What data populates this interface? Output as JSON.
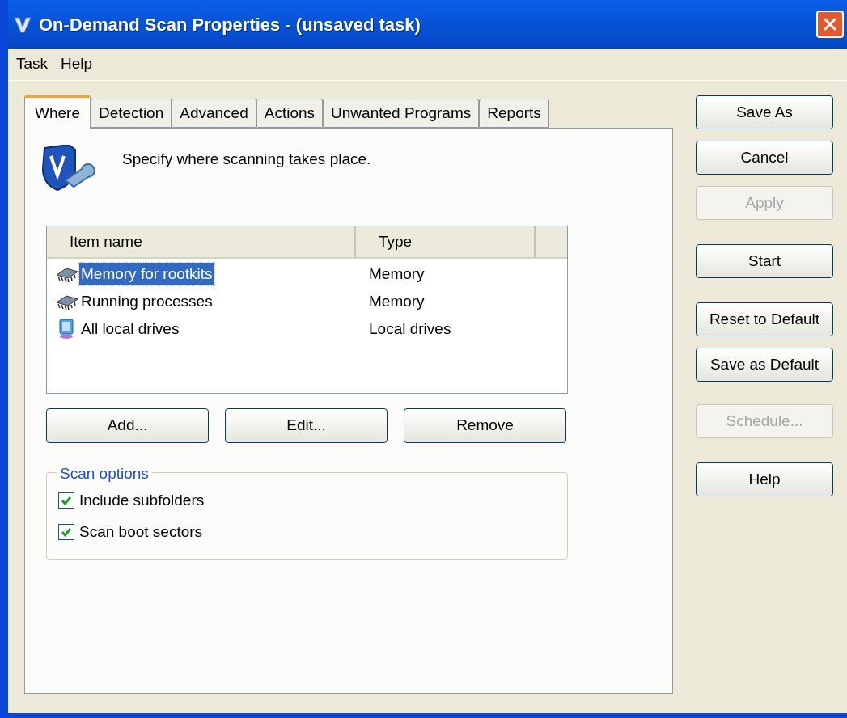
{
  "window": {
    "title": "On-Demand Scan Properties - (unsaved task)"
  },
  "menu": [
    "Task",
    "Help"
  ],
  "tabs": [
    {
      "label": "Where",
      "selected": true
    },
    {
      "label": "Detection",
      "selected": false
    },
    {
      "label": "Advanced",
      "selected": false
    },
    {
      "label": "Actions",
      "selected": false
    },
    {
      "label": "Unwanted Programs",
      "selected": false
    },
    {
      "label": "Reports",
      "selected": false
    }
  ],
  "description": "Specify where scanning takes place.",
  "table": {
    "columns": [
      "Item name",
      "Type"
    ],
    "rows": [
      {
        "kind": "memory",
        "name": "Memory for rootkits",
        "type": "Memory",
        "selected": true
      },
      {
        "kind": "memory",
        "name": "Running processes",
        "type": "Memory",
        "selected": false
      },
      {
        "kind": "drive",
        "name": "All local drives",
        "type": "Local drives",
        "selected": false
      }
    ]
  },
  "list_buttons": [
    "Add...",
    "Edit...",
    "Remove"
  ],
  "scan_options": {
    "title": "Scan options",
    "items": [
      {
        "label": "Include subfolders",
        "checked": true
      },
      {
        "label": "Scan boot sectors",
        "checked": true
      }
    ]
  },
  "side_buttons": [
    {
      "label": "Save As",
      "disabled": false
    },
    {
      "label": "Cancel",
      "disabled": false
    },
    {
      "label": "Apply",
      "disabled": true
    },
    {
      "label": "Start",
      "disabled": false
    },
    {
      "label": "Reset to Default",
      "disabled": false
    },
    {
      "label": "Save as Default",
      "disabled": false
    },
    {
      "label": "Schedule...",
      "disabled": true
    },
    {
      "label": "Help",
      "disabled": false
    }
  ]
}
